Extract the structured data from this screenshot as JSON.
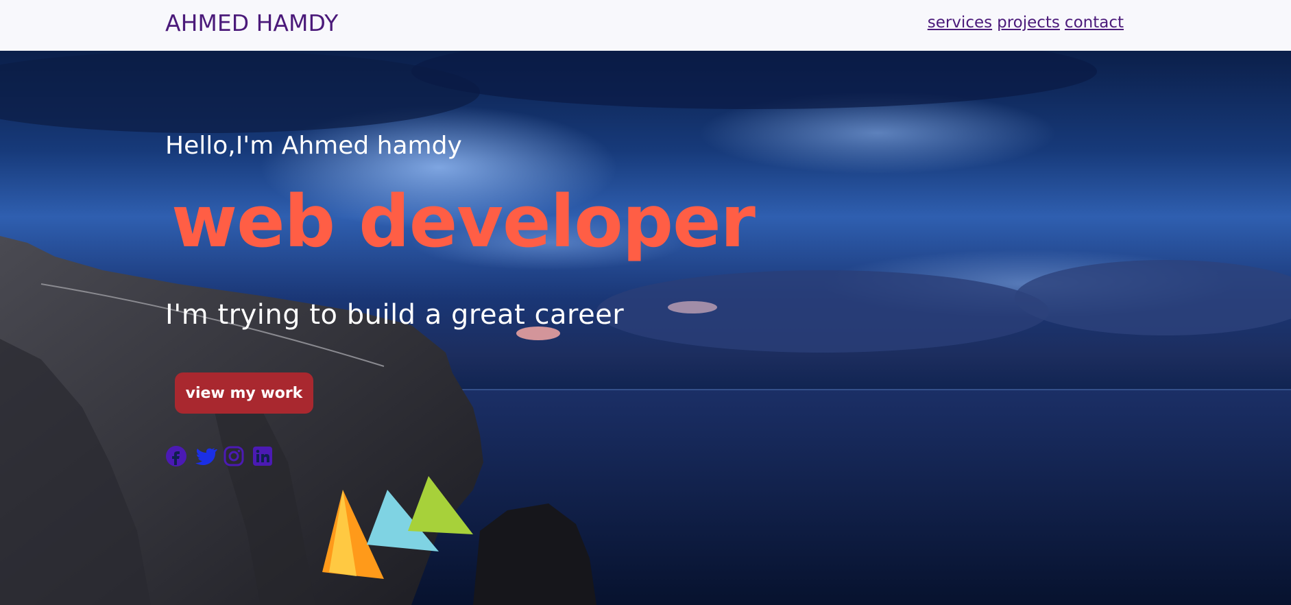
{
  "navbar": {
    "brand": "AHMED HAMDY",
    "links": [
      "services",
      "projects",
      "contact"
    ]
  },
  "hero": {
    "greeting": "Hello,I'm Ahmed hamdy",
    "role": "web developer",
    "tagline": "I'm trying to build a great career",
    "cta_label": "view my work"
  },
  "social_icons": [
    "facebook-icon",
    "twitter-icon",
    "instagram-icon",
    "linkedin-icon"
  ],
  "colors": {
    "brand": "#4b1a7a",
    "role_accent": "#ff5e45",
    "cta_bg": "#a9282f",
    "navbar_bg": "#f8f8fc"
  }
}
